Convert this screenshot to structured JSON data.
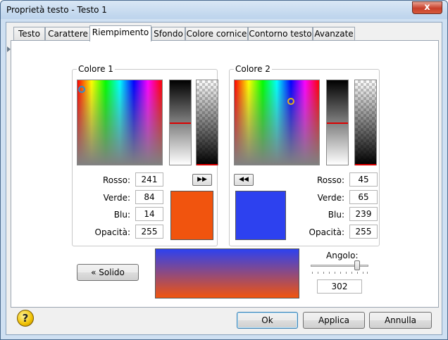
{
  "window": {
    "title": "Proprietà testo - Testo 1",
    "close_label": "x"
  },
  "tabs": [
    {
      "label": "Testo"
    },
    {
      "label": "Carattere"
    },
    {
      "label": "Riempimento"
    },
    {
      "label": "Sfondo"
    },
    {
      "label": "Colore cornice"
    },
    {
      "label": "Contorno testo"
    },
    {
      "label": "Avanzate"
    }
  ],
  "active_tab": "Riempimento",
  "color1": {
    "label": "Colore 1",
    "red_label": "Rosso:",
    "red": "241",
    "green_label": "Verde:",
    "green": "84",
    "blue_label": "Blu:",
    "blue": "14",
    "opacity_label": "Opacità:",
    "opacity": "255",
    "swatch_color": "#f1540e",
    "copy_button": "▶▶"
  },
  "color2": {
    "label": "Colore 2",
    "red_label": "Rosso:",
    "red": "45",
    "green_label": "Verde:",
    "green": "65",
    "blue_label": "Blu:",
    "blue": "239",
    "opacity_label": "Opacità:",
    "opacity": "255",
    "swatch_color": "#2d41ef",
    "copy_button": "◀◀"
  },
  "solid_button": "« Solido",
  "angle": {
    "label": "Angolo:",
    "value": "302"
  },
  "buttons": {
    "ok": "Ok",
    "apply": "Applica",
    "cancel": "Annulla"
  },
  "help_icon": "?"
}
